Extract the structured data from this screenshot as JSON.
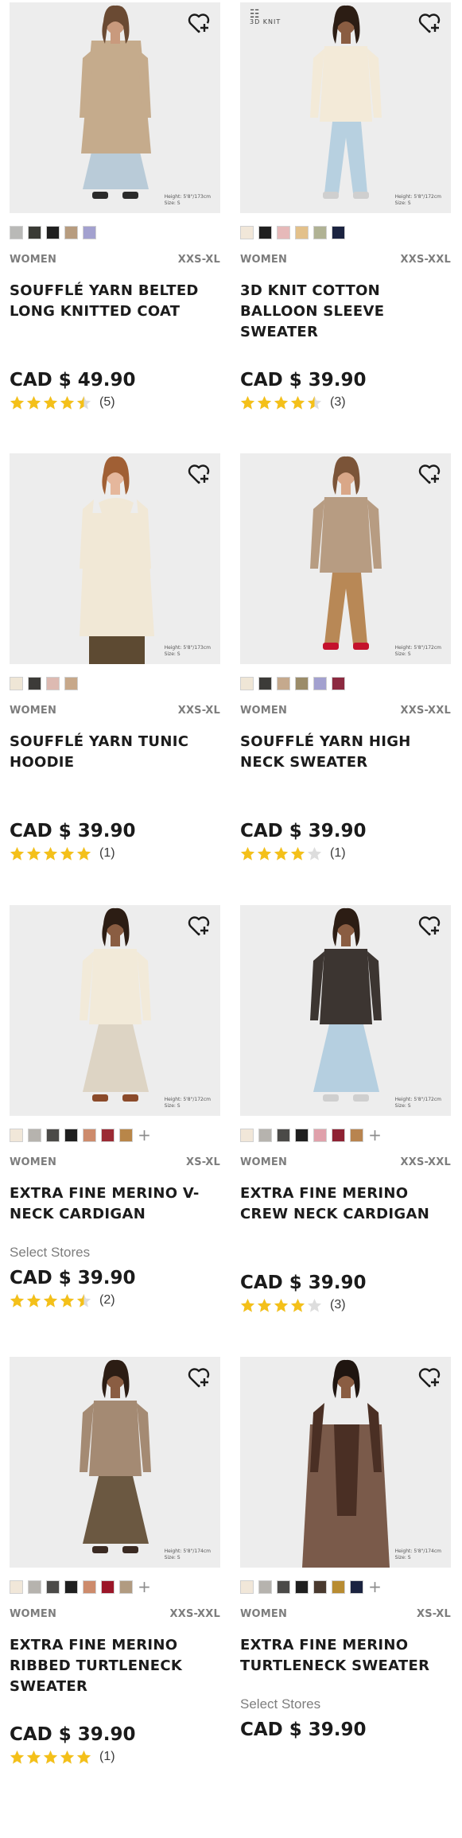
{
  "products": [
    {
      "name": "SOUFFLÉ YARN BELTED LONG KNITTED COAT",
      "gender": "WOMEN",
      "sizes": "XXS-XL",
      "price": "CAD $ 49.90",
      "rating": 4.5,
      "review_count": "(5)",
      "notice": "",
      "badge": "",
      "photo_note": [
        "Height: 5'8\"/173cm",
        "Size: S"
      ],
      "swatches": [
        "#b9b9b7",
        "#3a3b35",
        "#1f1f1f",
        "#b79c7f",
        "#a3a1cf"
      ],
      "more": "",
      "wishlist_icon": "heart-plus-icon",
      "outfit": {
        "skin": "#c99a7d",
        "hair": "#6a4a33",
        "top": "#c5ab8c",
        "bottom": "#b9cbd8",
        "shoes": "#2a2a2a",
        "style": "coat"
      }
    },
    {
      "name": "3D KNIT COTTON BALLOON SLEEVE SWEATER",
      "gender": "WOMEN",
      "sizes": "XXS-XXL",
      "price": "CAD $ 39.90",
      "rating": 4.5,
      "review_count": "(3)",
      "notice": "",
      "badge": "3D KNIT",
      "photo_note": [
        "Height: 5'8\"/172cm",
        "Size: S"
      ],
      "swatches": [
        "#f1e7d9",
        "#1f1f1f",
        "#e6b9b9",
        "#e3c18b",
        "#b0b294",
        "#1b2340"
      ],
      "more": "",
      "wishlist_icon": "heart-plus-icon",
      "outfit": {
        "skin": "#8a5d42",
        "hair": "#2c1d14",
        "top": "#f3ead8",
        "bottom": "#b7d0e0",
        "shoes": "#cfcfcf",
        "style": "sweater"
      }
    },
    {
      "name": "SOUFFLÉ YARN TUNIC HOODIE",
      "gender": "WOMEN",
      "sizes": "XXS-XL",
      "price": "CAD $ 39.90",
      "rating": 5,
      "review_count": "(1)",
      "notice": "",
      "badge": "",
      "photo_note": [
        "Height: 5'8\"/173cm",
        "Size: S"
      ],
      "swatches": [
        "#efe6d6",
        "#3c3b38",
        "#ddbab2",
        "#c7a88a"
      ],
      "more": "",
      "wishlist_icon": "heart-plus-icon",
      "outfit": {
        "skin": "#e5b79c",
        "hair": "#a05f34",
        "top": "#f1e8d6",
        "bottom": "#5d4a32",
        "shoes": "#5d4a32",
        "style": "hoodie"
      }
    },
    {
      "name": "SOUFFLÉ YARN HIGH NECK SWEATER",
      "gender": "WOMEN",
      "sizes": "XXS-XXL",
      "price": "CAD $ 39.90",
      "rating": 4,
      "review_count": "(1)",
      "notice": "",
      "badge": "",
      "photo_note": [
        "Height: 5'8\"/172cm",
        "Size: S"
      ],
      "swatches": [
        "#efe6d6",
        "#3c3b38",
        "#c5a98d",
        "#9b8c69",
        "#a3a1cf",
        "#8c2a40"
      ],
      "more": "",
      "wishlist_icon": "heart-plus-icon",
      "outfit": {
        "skin": "#d9a788",
        "hair": "#7b5438",
        "top": "#b79c82",
        "bottom": "#b88856",
        "shoes": "#c4122c",
        "style": "sweater"
      }
    },
    {
      "name": "EXTRA FINE MERINO V-NECK CARDIGAN",
      "gender": "WOMEN",
      "sizes": "XS-XL",
      "price": "CAD $ 39.90",
      "rating": 4.5,
      "review_count": "(2)",
      "notice": "Select Stores",
      "badge": "",
      "photo_note": [
        "Height: 5'8\"/172cm",
        "Size: S"
      ],
      "swatches": [
        "#f1e7d9",
        "#b6b3ae",
        "#4b4a48",
        "#1f1f1f",
        "#cd8b6c",
        "#9b2a34",
        "#b88649"
      ],
      "more": "+",
      "wishlist_icon": "heart-plus-icon",
      "outfit": {
        "skin": "#8a5d42",
        "hair": "#2c1d14",
        "top": "#f2ead9",
        "bottom": "#ddd4c4",
        "shoes": "#8b4a2a",
        "style": "cardigan"
      }
    },
    {
      "name": "EXTRA FINE MERINO CREW NECK CARDIGAN",
      "gender": "WOMEN",
      "sizes": "XXS-XXL",
      "price": "CAD $ 39.90",
      "rating": 4,
      "review_count": "(3)",
      "notice": "",
      "badge": "",
      "photo_note": [
        "Height: 5'8\"/172cm",
        "Size: S"
      ],
      "swatches": [
        "#f1e7d9",
        "#b6b3ae",
        "#4b4a48",
        "#1f1f1f",
        "#e0a1ab",
        "#8e2233",
        "#b8844f"
      ],
      "more": "+",
      "wishlist_icon": "heart-plus-icon",
      "outfit": {
        "skin": "#8a5d42",
        "hair": "#2c1d14",
        "top": "#3c3531",
        "bottom": "#b5cfe0",
        "shoes": "#cfcfcf",
        "style": "cardigan"
      }
    },
    {
      "name": "EXTRA FINE MERINO RIBBED TURTLENECK SWEATER",
      "gender": "WOMEN",
      "sizes": "XXS-XXL",
      "price": "CAD $ 39.90",
      "rating": 5,
      "review_count": "(1)",
      "notice": "",
      "badge": "",
      "photo_note": [
        "Height: 5'8\"/174cm",
        "Size: S"
      ],
      "swatches": [
        "#f1e7d9",
        "#b6b3ae",
        "#4b4a48",
        "#1f1f1f",
        "#cd8b6c",
        "#9b1628",
        "#b19b81"
      ],
      "more": "+",
      "wishlist_icon": "heart-plus-icon",
      "outfit": {
        "skin": "#8a5d42",
        "hair": "#2c1d14",
        "top": "#a48a73",
        "bottom": "#6b5841",
        "shoes": "#3a2a22",
        "style": "turtleneck"
      }
    },
    {
      "name": "EXTRA FINE MERINO TURTLENECK SWEATER",
      "gender": "WOMEN",
      "sizes": "XS-XL",
      "price": "CAD $ 39.90",
      "rating": 0,
      "review_count": "",
      "notice": "Select Stores",
      "badge": "",
      "photo_note": [
        "Height: 5'8\"/174cm",
        "Size: S"
      ],
      "swatches": [
        "#f1e7d9",
        "#b6b3ae",
        "#4b4a48",
        "#1f1f1f",
        "#4a3a2f",
        "#b88c32",
        "#1b2340"
      ],
      "more": "+",
      "wishlist_icon": "heart-plus-icon",
      "outfit": {
        "skin": "#8a5d42",
        "hair": "#1f1510",
        "top": "#4a2f24",
        "bottom": "#1c1c1c",
        "shoes": "#1c1c1c",
        "style": "blazer"
      }
    }
  ],
  "colors": {
    "star_filled": "#f4c019",
    "star_empty": "#dddddd",
    "text_muted": "#7d7d7d",
    "photo_bg": "#ececec"
  }
}
